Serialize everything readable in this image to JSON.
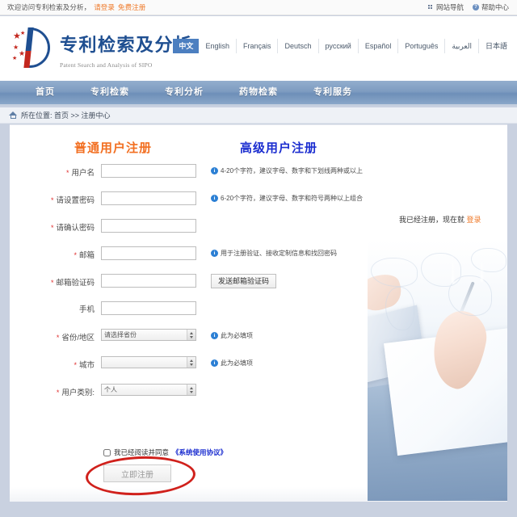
{
  "topbar": {
    "welcome": "欢迎访问专利检索及分析，",
    "login_link": "请登录",
    "register_link": "免费注册",
    "site_nav": "网站导航",
    "help_center": "帮助中心",
    "grid_icon": "grid-icon",
    "help_icon": "question-icon"
  },
  "logo": {
    "cn": "专利检索及分析",
    "en": "Patent Search and Analysis of SIPO"
  },
  "languages": [
    {
      "label": "中文",
      "active": true
    },
    {
      "label": "English",
      "active": false
    },
    {
      "label": "Français",
      "active": false
    },
    {
      "label": "Deutsch",
      "active": false
    },
    {
      "label": "русский",
      "active": false
    },
    {
      "label": "Español",
      "active": false
    },
    {
      "label": "Português",
      "active": false
    },
    {
      "label": "العربية",
      "active": false
    },
    {
      "label": "日本語",
      "active": false
    }
  ],
  "nav": [
    {
      "label": "首页"
    },
    {
      "label": "专利检索"
    },
    {
      "label": "专利分析"
    },
    {
      "label": "药物检索"
    },
    {
      "label": "专利服务"
    }
  ],
  "breadcrumb": {
    "icon": "home-icon",
    "text": "所在位置: 首页 >> 注册中心"
  },
  "headings": {
    "normal_user": "普通用户注册",
    "advanced_user": "高级用户注册",
    "normal_color": "#f26f21",
    "advanced_color": "#1d2fd0"
  },
  "form": {
    "fields": [
      {
        "name": "username",
        "label": "用户名",
        "required": true,
        "type": "text",
        "value": "",
        "hint": "4-20个字符，建议字母、数字和下划线两种或以上"
      },
      {
        "name": "password",
        "label": "请设置密码",
        "required": true,
        "type": "password",
        "value": "",
        "hint": "6-20个字符，建议字母、数字和符号两种以上组合"
      },
      {
        "name": "confirm-password",
        "label": "请确认密码",
        "required": true,
        "type": "password",
        "value": "",
        "hint": ""
      },
      {
        "name": "email",
        "label": "邮箱",
        "required": true,
        "type": "text",
        "value": "",
        "hint": "用于注册验证、接收定制信息和找回密码"
      },
      {
        "name": "email-code",
        "label": "邮箱验证码",
        "required": true,
        "type": "text",
        "value": "",
        "button": "发送邮箱验证码"
      },
      {
        "name": "mobile",
        "label": "手机",
        "required": false,
        "type": "text",
        "value": "",
        "hint": ""
      },
      {
        "name": "province",
        "label": "省份/地区",
        "required": true,
        "type": "select",
        "value": "请选择省份",
        "hint": "此为必填项"
      },
      {
        "name": "city",
        "label": "城市",
        "required": true,
        "type": "select",
        "value": "",
        "hint": "此为必填项"
      },
      {
        "name": "user-type",
        "label": "用户类别:",
        "required": true,
        "type": "select",
        "value": "个人",
        "hint": ""
      }
    ],
    "agreement": {
      "checked": false,
      "text": "我已经阅读并同意",
      "link": "《系统使用协议》"
    },
    "submit_label": "立即注册",
    "annotation_color": "#d0211c"
  },
  "sidebar": {
    "already_text": "我已经注册，现在就 ",
    "login_link": "登录"
  }
}
